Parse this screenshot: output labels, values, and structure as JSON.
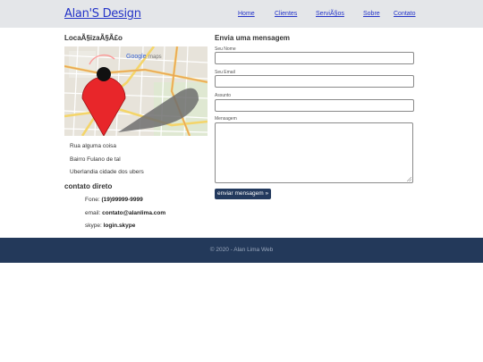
{
  "header": {
    "logo": "Alan'S Design",
    "nav": [
      "Home",
      "Clientes",
      "ServiÃ§os",
      "Sobre",
      "Contato"
    ]
  },
  "location": {
    "title": "LocaÃ§izaÃ§Ã£o",
    "map_brand": "Google maps",
    "address": [
      "Rua alguma coisa",
      "Bairro Fulano de tal",
      "Uberlandia cidade dos ubers"
    ]
  },
  "contact": {
    "title": "contato direto",
    "phone_label": "Fone:",
    "phone": "(19)99999-9999",
    "email_label": "email:",
    "email": "contato@alanlima.com",
    "skype_label": "skype:",
    "skype": "login.skype"
  },
  "form": {
    "title": "Envia uma mensagem",
    "name_label": "Seu Nome",
    "email_label": "Seu Email",
    "subject_label": "Assunto",
    "message_label": "Mensagem",
    "submit": "enviar mensagem »"
  },
  "footer": {
    "text": "© 2020 - Alan Lima Web"
  },
  "colors": {
    "header_bg": "#e4e6e9",
    "link": "#2434c8",
    "button_bg": "#233a5e",
    "footer_bg": "#23395a",
    "pin": "#e8262a"
  }
}
